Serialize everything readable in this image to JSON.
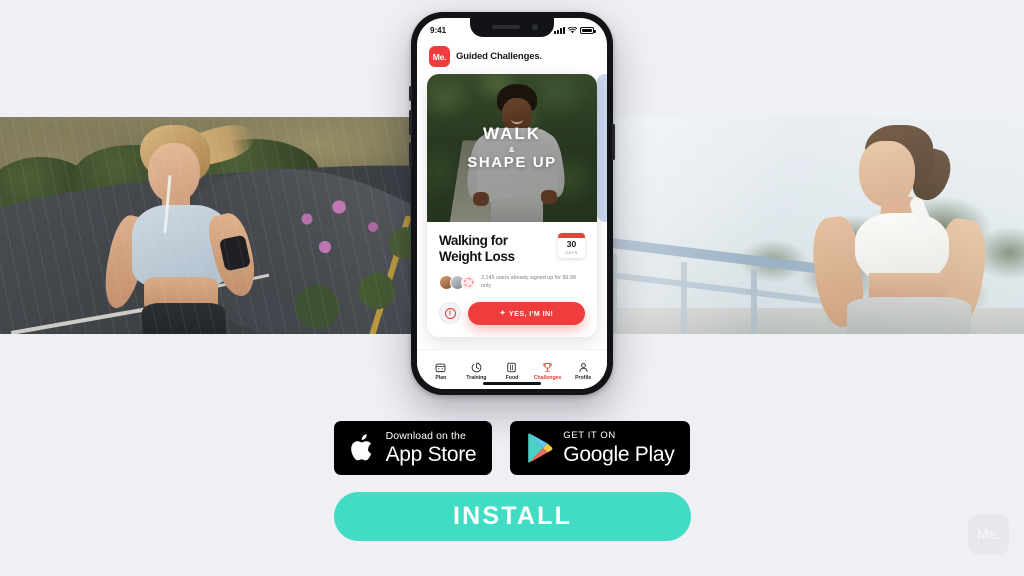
{
  "page": {
    "background_color": "#eff0f4",
    "accent_teal": "#41dcc3",
    "accent_red": "#ef3c3c"
  },
  "photos": {
    "left": {
      "name": "woman-running-mountain-road",
      "alt": "Woman running on a wet mountain road in the rain"
    },
    "right": {
      "name": "woman-resting-railing",
      "alt": "Woman in white sports bra catching her breath by a railing"
    }
  },
  "phone": {
    "status_bar": {
      "time": "9:41",
      "signal_icon": "cellular-signal-icon",
      "wifi_icon": "wifi-icon",
      "battery_icon": "battery-icon"
    },
    "app_header": {
      "logo_text": "Me.",
      "title": "Guided Challenges."
    },
    "card": {
      "hero": {
        "line1": "WALK",
        "amp": "&",
        "line2": "SHAPE UP",
        "image_alt": "Smiling woman walking on a leafy path"
      },
      "title": "Walking for\nWeight Loss",
      "title_line1": "Walking for",
      "title_line2": "Weight Loss",
      "days_badge": {
        "number": "30",
        "label": "DAYS"
      },
      "social_proof": "2,145 users already signed up for $9.99 only",
      "avatars": [
        "avatar-user-1",
        "avatar-user-2",
        "avatar-user-3"
      ],
      "info_button_label": "i",
      "cta_label": "YES, I'M IN!",
      "cta_spark": "✦"
    },
    "tabbar": [
      {
        "label": "Plan",
        "icon": "calendar-icon",
        "active": false
      },
      {
        "label": "Training",
        "icon": "activity-icon",
        "active": false
      },
      {
        "label": "Food",
        "icon": "food-icon",
        "active": false
      },
      {
        "label": "Challenges",
        "icon": "trophy-icon",
        "active": true
      },
      {
        "label": "Profile",
        "icon": "person-icon",
        "active": false
      }
    ]
  },
  "store_badges": [
    {
      "icon": "apple-logo-icon",
      "small": "Download on the",
      "big": "App Store"
    },
    {
      "icon": "google-play-icon",
      "small": "GET IT ON",
      "big": "Google Play"
    }
  ],
  "install_button": {
    "label": "INSTALL"
  },
  "watermark": {
    "text": "Me."
  }
}
